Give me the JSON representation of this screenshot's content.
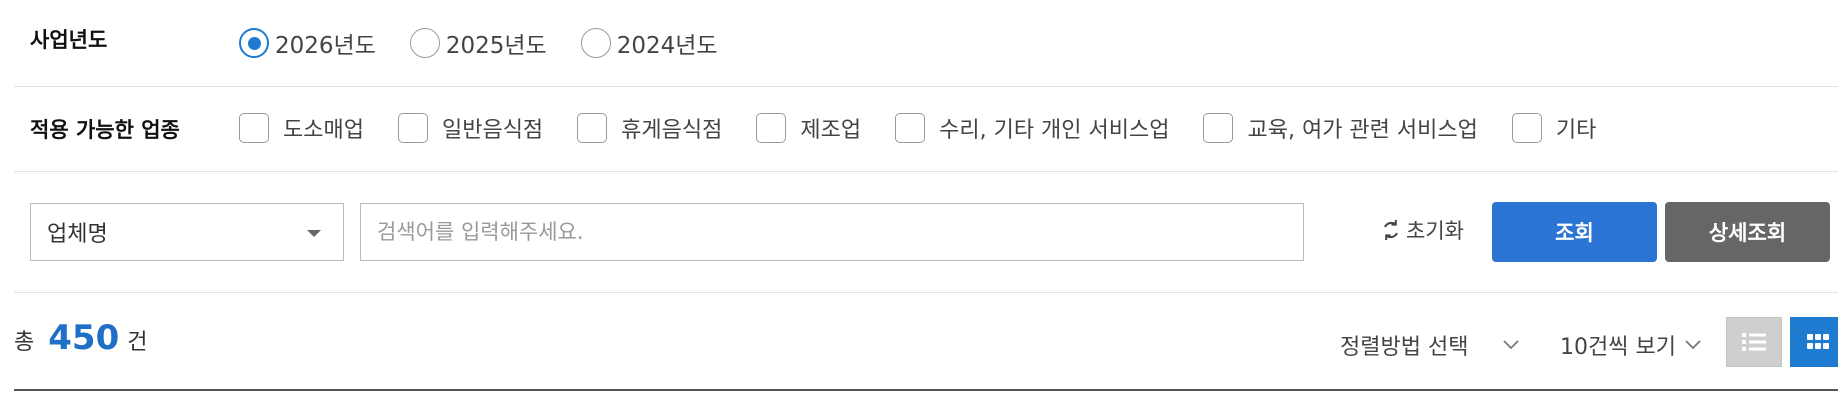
{
  "year_filter": {
    "label": "사업년도",
    "options": [
      {
        "label": "2026년도",
        "checked": true
      },
      {
        "label": "2025년도",
        "checked": false
      },
      {
        "label": "2024년도",
        "checked": false
      }
    ]
  },
  "industry_filter": {
    "label": "적용 가능한 업종",
    "options": [
      {
        "label": "도소매업",
        "checked": false
      },
      {
        "label": "일반음식점",
        "checked": false
      },
      {
        "label": "휴게음식점",
        "checked": false
      },
      {
        "label": "제조업",
        "checked": false
      },
      {
        "label": "수리, 기타 개인 서비스업",
        "checked": false
      },
      {
        "label": "교육, 여가 관련 서비스업",
        "checked": false
      },
      {
        "label": "기타",
        "checked": false
      }
    ]
  },
  "search": {
    "field_select": "업체명",
    "placeholder": "검색어를 입력해주세요.",
    "value": "",
    "reset_label": "초기화",
    "search_label": "조회",
    "detail_label": "상세조회"
  },
  "results": {
    "total_prefix": "총",
    "total_count": "450",
    "total_suffix": "건",
    "sort_label": "정렬방법 선택",
    "per_page_label": "10건씩 보기"
  },
  "colors": {
    "accent": "#1f7bd0",
    "search_button": "#2b74d3",
    "detail_button": "#666666",
    "count_text": "#1f6fc8"
  }
}
